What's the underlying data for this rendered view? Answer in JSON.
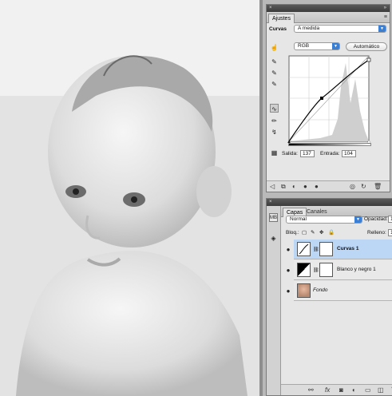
{
  "adjustments": {
    "tab": "Ajustes",
    "type_label": "Curvas",
    "preset": "A medida",
    "channel": "RGB",
    "auto_button": "Automático",
    "output_label": "Salida:",
    "output_value": "137",
    "input_label": "Entrada:",
    "input_value": "104"
  },
  "layers": {
    "tabs": [
      "Capas",
      "Canales"
    ],
    "blend_mode": "Normal",
    "opacity_label": "Opacidad:",
    "opacity_value": "1",
    "lock_label": "Bloq.:",
    "fill_label": "Relleno:",
    "fill_value": "1",
    "items": [
      {
        "name": "Curvas 1",
        "selected": true
      },
      {
        "name": "Blanco y negro 1",
        "selected": false
      },
      {
        "name": "Fondo",
        "selected": false
      }
    ]
  },
  "icons": {
    "close": "×",
    "collapse": "»",
    "menu": "≡",
    "eye": "●",
    "chain": "⛓",
    "fx": "fx"
  },
  "colors": {
    "selection": "#bcd6f6",
    "accent": "#3a7fd6"
  }
}
